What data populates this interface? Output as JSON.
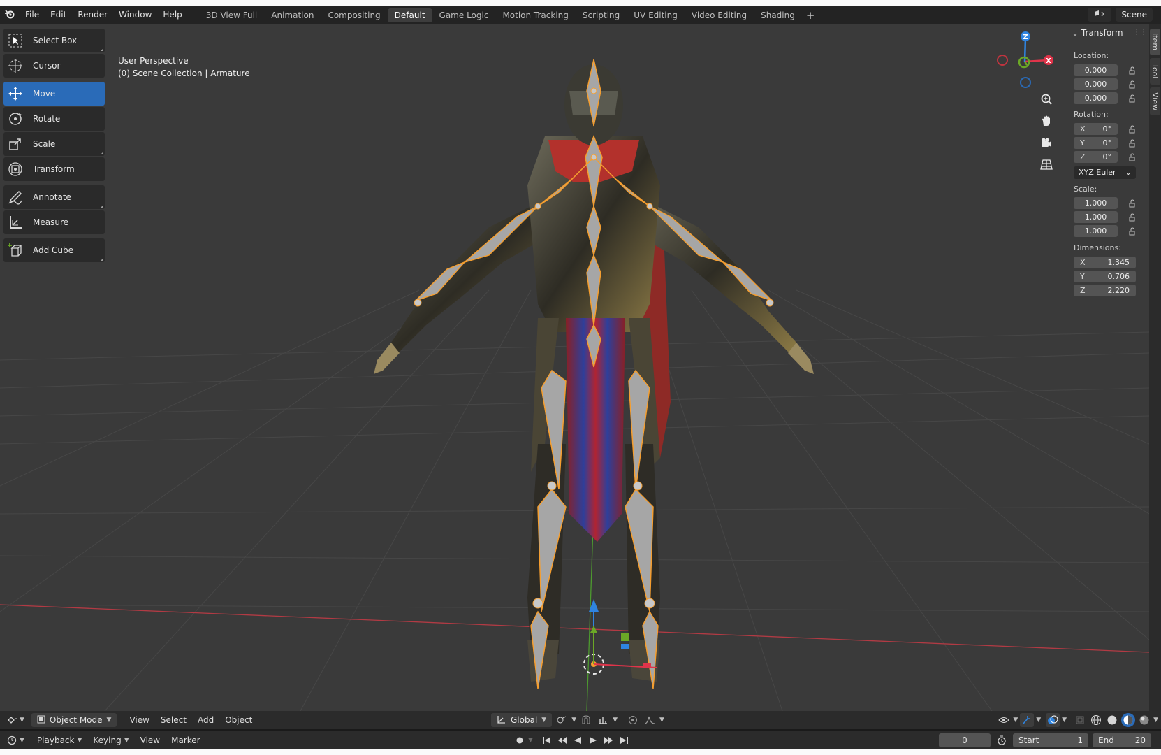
{
  "app": {
    "menus": [
      "File",
      "Edit",
      "Render",
      "Window",
      "Help"
    ],
    "workspaces": [
      "3D View Full",
      "Animation",
      "Compositing",
      "Default",
      "Game Logic",
      "Motion Tracking",
      "Scripting",
      "UV Editing",
      "Video Editing",
      "Shading"
    ],
    "active_workspace": "Default",
    "scene_name": "Scene"
  },
  "viewport": {
    "perspective_label": "User Perspective",
    "collection_label": "(0) Scene Collection | Armature"
  },
  "toolbar": {
    "tools": [
      "Select Box",
      "Cursor",
      "Move",
      "Rotate",
      "Scale",
      "Transform",
      "Annotate",
      "Measure",
      "Add Cube"
    ],
    "active_tool": "Move"
  },
  "gizmo": {
    "x_label": "X",
    "y_label": "Y",
    "z_label": "Z"
  },
  "npanel": {
    "title": "Transform",
    "location_label": "Location:",
    "location": [
      "0.000",
      "0.000",
      "0.000"
    ],
    "rotation_label": "Rotation:",
    "rotation": [
      {
        "axis": "X",
        "value": "0°"
      },
      {
        "axis": "Y",
        "value": "0°"
      },
      {
        "axis": "Z",
        "value": "0°"
      }
    ],
    "rotation_mode": "XYZ Euler",
    "scale_label": "Scale:",
    "scale": [
      "1.000",
      "1.000",
      "1.000"
    ],
    "dimensions_label": "Dimensions:",
    "dimensions": [
      {
        "axis": "X",
        "value": "1.345"
      },
      {
        "axis": "Y",
        "value": "0.706"
      },
      {
        "axis": "Z",
        "value": "2.220"
      }
    ]
  },
  "sidetabs": [
    "Item",
    "Tool",
    "View"
  ],
  "viewport_header": {
    "mode": "Object Mode",
    "menus": [
      "View",
      "Select",
      "Add",
      "Object"
    ],
    "orientation": "Global"
  },
  "timeline": {
    "menus": [
      "Playback",
      "Keying",
      "View",
      "Marker"
    ],
    "current_frame": "0",
    "start_label": "Start",
    "start": "1",
    "end_label": "End",
    "end": "20"
  },
  "colors": {
    "accent": "#2a6bb8",
    "viewport_bg": "#3a3a3a",
    "x_axis": "#e0344a",
    "y_axis": "#6ba826",
    "z_axis": "#2f84e0",
    "bone_outline": "#f59e2f"
  }
}
